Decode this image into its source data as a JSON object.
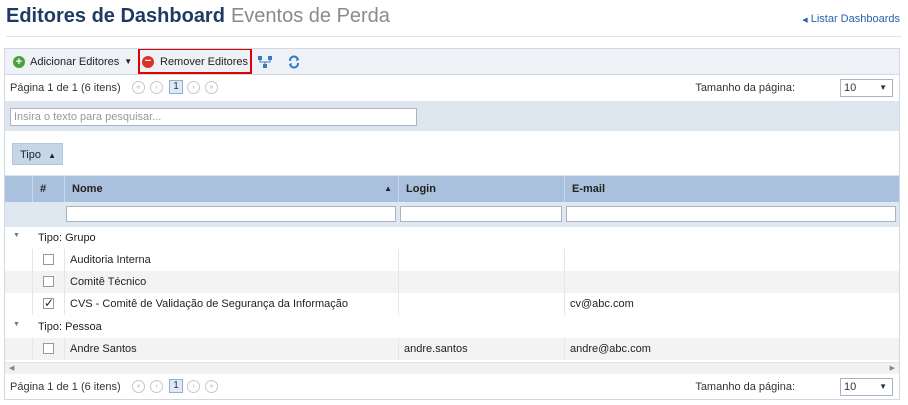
{
  "header": {
    "title": "Editores de Dashboard",
    "subtitle": "Eventos de Perda",
    "link": "Listar Dashboards"
  },
  "toolbar": {
    "add_label": "Adicionar Editores",
    "remove_label": "Remover Editores"
  },
  "pager": {
    "text": "Página 1 de 1 (6 itens)",
    "current_page": "1",
    "page_size_label": "Tamanho da página:",
    "page_size": "10"
  },
  "search": {
    "placeholder": "Insira o texto para pesquisar..."
  },
  "group": {
    "label": "Tipo"
  },
  "columns": {
    "num": "#",
    "name": "Nome",
    "login": "Login",
    "email": "E-mail"
  },
  "groups": [
    {
      "label": "Tipo: Grupo",
      "rows": [
        {
          "name": "Auditoria Interna",
          "login": "",
          "email": "",
          "checked": false
        },
        {
          "name": "Comitê Técnico",
          "login": "",
          "email": "",
          "checked": false
        },
        {
          "name": "CVS - Comitê de Validação de Segurança da Informação",
          "login": "",
          "email": "cv@abc.com",
          "checked": true
        }
      ]
    },
    {
      "label": "Tipo: Pessoa",
      "rows": [
        {
          "name": "Andre Santos",
          "login": "andre.santos",
          "email": "andre@abc.com",
          "checked": false
        }
      ]
    }
  ]
}
